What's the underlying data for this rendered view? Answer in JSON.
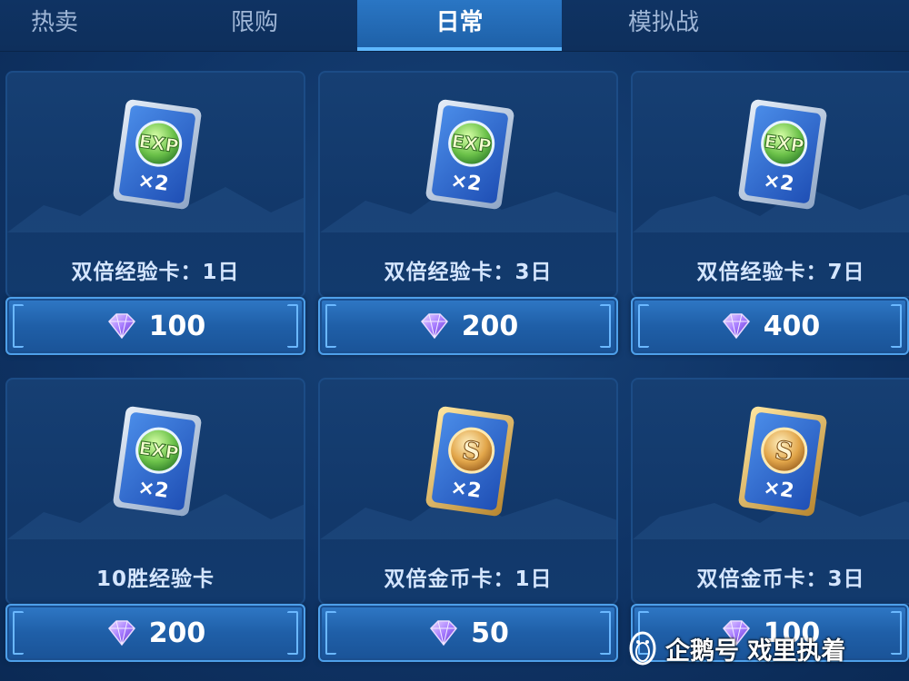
{
  "tabs": [
    {
      "label": "热卖",
      "active": false
    },
    {
      "label": "限购",
      "active": false
    },
    {
      "label": "日常",
      "active": true
    },
    {
      "label": "模拟战",
      "active": false
    }
  ],
  "items": [
    {
      "name": "双倍经验卡：1日",
      "price": "100",
      "icon": "exp-card-icon",
      "badge": "EXP",
      "multiplier": "×2"
    },
    {
      "name": "双倍经验卡：3日",
      "price": "200",
      "icon": "exp-card-icon",
      "badge": "EXP",
      "multiplier": "×2"
    },
    {
      "name": "双倍经验卡：7日",
      "price": "400",
      "icon": "exp-card-icon",
      "badge": "EXP",
      "multiplier": "×2"
    },
    {
      "name": "10胜经验卡",
      "price": "200",
      "icon": "exp-card-icon",
      "badge": "EXP",
      "multiplier": "×2"
    },
    {
      "name": "双倍金币卡：1日",
      "price": "50",
      "icon": "gold-card-icon",
      "badge": "S",
      "multiplier": "×2"
    },
    {
      "name": "双倍金币卡：3日",
      "price": "100",
      "icon": "gold-card-icon",
      "badge": "S",
      "multiplier": "×2"
    }
  ],
  "currency_icon": "diamond-gem-icon",
  "watermark": {
    "text": "企鹅号 戏里执着",
    "icon": "penguin-logo-icon"
  },
  "colors": {
    "background": "#0f3466",
    "active_tab": "#2a76c4",
    "price_button": "#2369b4",
    "gem": "#9b6cff"
  }
}
